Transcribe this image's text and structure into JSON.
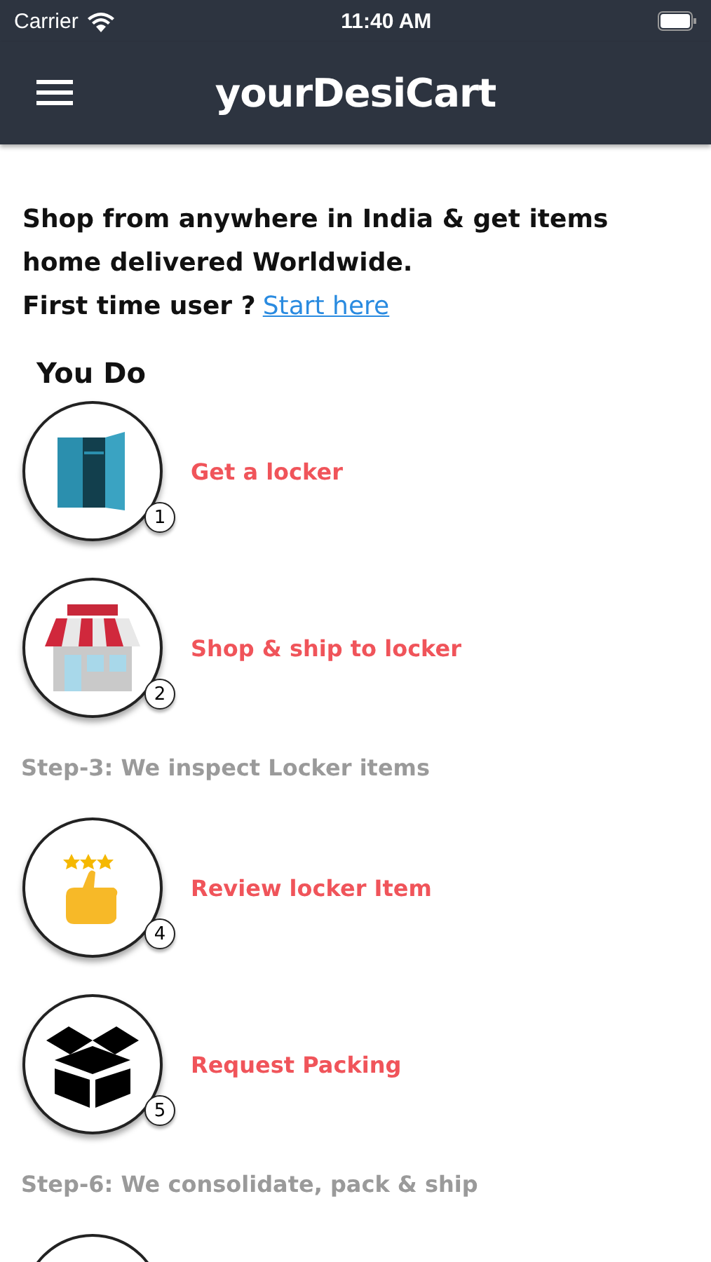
{
  "status_bar": {
    "carrier": "Carrier",
    "time": "11:40 AM"
  },
  "nav_bar": {
    "title": "yourDesiCart"
  },
  "intro": {
    "text": "Shop from anywhere in India & get items home delivered Worldwide.",
    "question": "First time user ?",
    "link": "Start here"
  },
  "section_title": "You Do",
  "steps": [
    {
      "kind": "user",
      "number": "1",
      "title": "Get a locker"
    },
    {
      "kind": "user",
      "number": "2",
      "title": "Shop & ship to locker"
    },
    {
      "kind": "note",
      "title": "Step-3: We inspect Locker items"
    },
    {
      "kind": "user",
      "number": "4",
      "title": "Review locker Item"
    },
    {
      "kind": "user",
      "number": "5",
      "title": "Request Packing"
    },
    {
      "kind": "note",
      "title": "Step-6: We consolidate, pack & ship"
    }
  ]
}
